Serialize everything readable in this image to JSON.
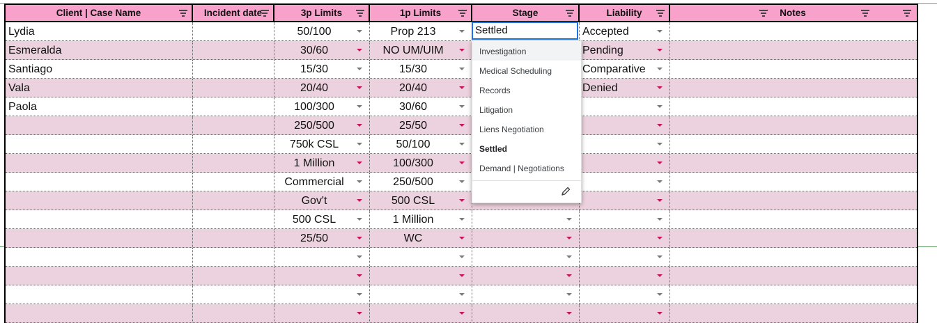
{
  "columns": [
    {
      "label": "Client | Case Name"
    },
    {
      "label": "Incident date"
    },
    {
      "label": "3p Limits"
    },
    {
      "label": "1p Limits"
    },
    {
      "label": "Stage"
    },
    {
      "label": "Liability"
    },
    {
      "label": "Notes"
    }
  ],
  "rows": [
    {
      "client": "Lydia",
      "limits_3p": "50/100",
      "limits_1p": "Prop 213",
      "stage": "",
      "liability": "Accepted"
    },
    {
      "client": "Esmeralda",
      "limits_3p": "30/60",
      "limits_1p": "NO UM/UIM",
      "stage": "",
      "liability": "Pending"
    },
    {
      "client": "Santiago",
      "limits_3p": "15/30",
      "limits_1p": "15/30",
      "stage": "",
      "liability": "Comparative"
    },
    {
      "client": "Vala",
      "limits_3p": "20/40",
      "limits_1p": "20/40",
      "stage": "",
      "liability": "Denied"
    },
    {
      "client": "Paola",
      "limits_3p": "100/300",
      "limits_1p": "30/60",
      "stage": "",
      "liability": ""
    },
    {
      "client": "",
      "limits_3p": "250/500",
      "limits_1p": "25/50",
      "stage": "",
      "liability": ""
    },
    {
      "client": "",
      "limits_3p": "750k CSL",
      "limits_1p": "50/100",
      "stage": "",
      "liability": ""
    },
    {
      "client": "",
      "limits_3p": "1 Million",
      "limits_1p": "100/300",
      "stage": "",
      "liability": ""
    },
    {
      "client": "",
      "limits_3p": "Commercial",
      "limits_1p": "250/500",
      "stage": "",
      "liability": ""
    },
    {
      "client": "",
      "limits_3p": "Gov't",
      "limits_1p": "500 CSL",
      "stage": "",
      "liability": ""
    },
    {
      "client": "",
      "limits_3p": "500 CSL",
      "limits_1p": "1 Million",
      "stage": "",
      "liability": ""
    },
    {
      "client": "",
      "limits_3p": "25/50",
      "limits_1p": "WC",
      "stage": "",
      "liability": ""
    },
    {
      "client": "",
      "limits_3p": "",
      "limits_1p": "",
      "stage": "",
      "liability": ""
    },
    {
      "client": "",
      "limits_3p": "",
      "limits_1p": "",
      "stage": "",
      "liability": ""
    },
    {
      "client": "",
      "limits_3p": "",
      "limits_1p": "",
      "stage": "",
      "liability": ""
    },
    {
      "client": "",
      "limits_3p": "",
      "limits_1p": "",
      "stage": "",
      "liability": ""
    }
  ],
  "stage_dropdown": {
    "current_value": "Settled",
    "options": [
      "Investigation",
      "Medical Scheduling",
      "Records",
      "Litigation",
      "Liens Negotiation",
      "Settled",
      "Demand | Negotiations"
    ],
    "selected": "Settled",
    "hovered": "Investigation"
  },
  "icons": {
    "filter": "filter-icon",
    "dropdown": "chevron-down-icon",
    "edit": "pencil-icon"
  },
  "colors": {
    "header_bg": "#f7a1cb",
    "alt_row_bg": "#ecd2de",
    "caret_pink": "#c2185b",
    "focus_blue": "#1a73e8",
    "freeze_line": "#2e7d32"
  }
}
